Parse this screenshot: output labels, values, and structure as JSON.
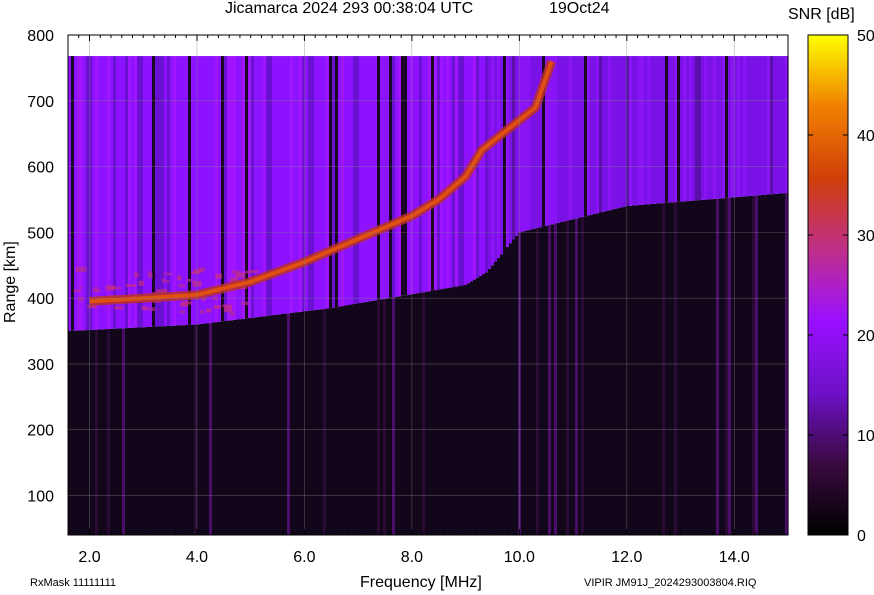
{
  "chart_data": {
    "type": "heatmap",
    "title": "Jicamarca 2024 293 00:38:04 UTC",
    "date": "19Oct24",
    "xlabel": "Frequency [MHz]",
    "ylabel": "Range [km]",
    "colorbar_label": "SNR [dB]",
    "xlim": [
      1.6,
      15.0
    ],
    "ylim": [
      40,
      800
    ],
    "x_ticks": [
      "2.0",
      "4.0",
      "6.0",
      "8.0",
      "10.0",
      "12.0",
      "14.0"
    ],
    "x_tick_values": [
      2,
      4,
      6,
      8,
      10,
      12,
      14
    ],
    "y_ticks": [
      "100",
      "200",
      "300",
      "400",
      "500",
      "600",
      "700",
      "800"
    ],
    "y_tick_values": [
      100,
      200,
      300,
      400,
      500,
      600,
      700,
      800
    ],
    "colorbar_ticks": [
      "0",
      "10",
      "20",
      "30",
      "40",
      "50"
    ],
    "colorbar_values": [
      0,
      10,
      20,
      30,
      40,
      50
    ],
    "colormap": [
      "#000000",
      "#3a0a40",
      "#6d10c8",
      "#9a0fff",
      "#c0308a",
      "#d0400a",
      "#f08000",
      "#ffff00"
    ],
    "grid": true,
    "trace": {
      "name": "echo trace",
      "points": [
        {
          "f": 2.0,
          "range": 395
        },
        {
          "f": 3.0,
          "range": 400
        },
        {
          "f": 4.0,
          "range": 405
        },
        {
          "f": 5.0,
          "range": 425
        },
        {
          "f": 6.0,
          "range": 455
        },
        {
          "f": 7.0,
          "range": 490
        },
        {
          "f": 8.0,
          "range": 525
        },
        {
          "f": 8.5,
          "range": 550
        },
        {
          "f": 9.0,
          "range": 585
        },
        {
          "f": 9.3,
          "range": 625
        },
        {
          "f": 10.3,
          "range": 690
        },
        {
          "f": 10.6,
          "range": 760
        }
      ]
    },
    "lower_edge": [
      {
        "f": 1.6,
        "range": 350
      },
      {
        "f": 4.0,
        "range": 360
      },
      {
        "f": 5.0,
        "range": 370
      },
      {
        "f": 6.5,
        "range": 385
      },
      {
        "f": 7.2,
        "range": 395
      },
      {
        "f": 9.0,
        "range": 420
      },
      {
        "f": 9.4,
        "range": 440
      },
      {
        "f": 10.0,
        "range": 500
      },
      {
        "f": 11.0,
        "range": 520
      },
      {
        "f": 12.0,
        "range": 540
      },
      {
        "f": 15.0,
        "range": 560
      }
    ]
  },
  "footer": {
    "rxmask": "RxMask 11111111",
    "file": "VIPIR  JM91J_2024293003804.RIQ"
  }
}
